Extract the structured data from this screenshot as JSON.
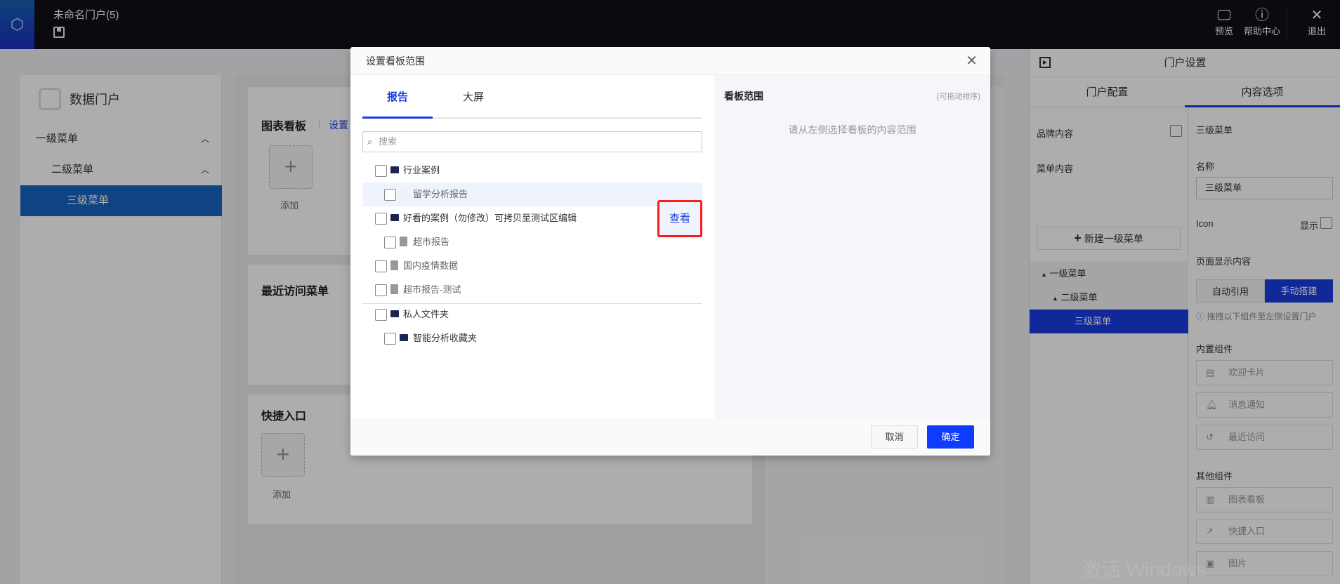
{
  "topbar": {
    "title": "未命名门户(5)",
    "preview": "预览",
    "help": "帮助中心",
    "exit": "退出"
  },
  "left_panel": {
    "brand": "数据门户",
    "menu": [
      {
        "label": "一级菜单"
      },
      {
        "label": "二级菜单"
      },
      {
        "label": "三级菜单"
      }
    ]
  },
  "main": {
    "card1": {
      "title": "图表看板",
      "link": "设置",
      "add": "添加"
    },
    "card2": {
      "title": "最近访问菜单"
    },
    "card3": {
      "title": "快捷入口",
      "add": "添加"
    }
  },
  "sidebar": {
    "title": "门户设置",
    "tabs": [
      "门户配置",
      "内容选项"
    ],
    "brand_content": "品牌内容",
    "menu_content": "菜单内容",
    "new_menu": "新建一级菜单",
    "tree": [
      "一级菜单",
      "二级菜单",
      "三级菜单"
    ],
    "selected_title": "三级菜单",
    "name_label": "名称",
    "name_value": "三级菜单",
    "icon_label": "Icon",
    "show_label": "显示",
    "page_content_label": "页面显示内容",
    "seg_auto": "自动引用",
    "seg_manual": "手动搭建",
    "hint": "拖拽以下组件至左侧设置门户",
    "builtin_title": "内置组件",
    "builtin": [
      "欢迎卡片",
      "消息通知",
      "最近访问"
    ],
    "other_title": "其他组件",
    "other": [
      "图表看板",
      "快捷入口",
      "图片"
    ]
  },
  "dialog": {
    "title": "设置看板范围",
    "tabs": [
      "报告",
      "大屏"
    ],
    "search_placeholder": "搜索",
    "tree": [
      {
        "label": "行业案例"
      },
      {
        "label": "留学分析报告"
      },
      {
        "label": "好看的案例（勿修改）可拷贝至测试区编辑"
      },
      {
        "label": "超市报告"
      },
      {
        "label": "国内疫情数据"
      },
      {
        "label": "超市报告-测试"
      },
      {
        "label": "私人文件夹"
      },
      {
        "label": "智能分析收藏夹"
      }
    ],
    "view": "查看",
    "right_title": "看板范围",
    "right_hint": "(可拖动排序)",
    "empty": "请从左侧选择看板的内容范围",
    "cancel": "取消",
    "ok": "确定"
  },
  "watermark": "激活 Windows"
}
